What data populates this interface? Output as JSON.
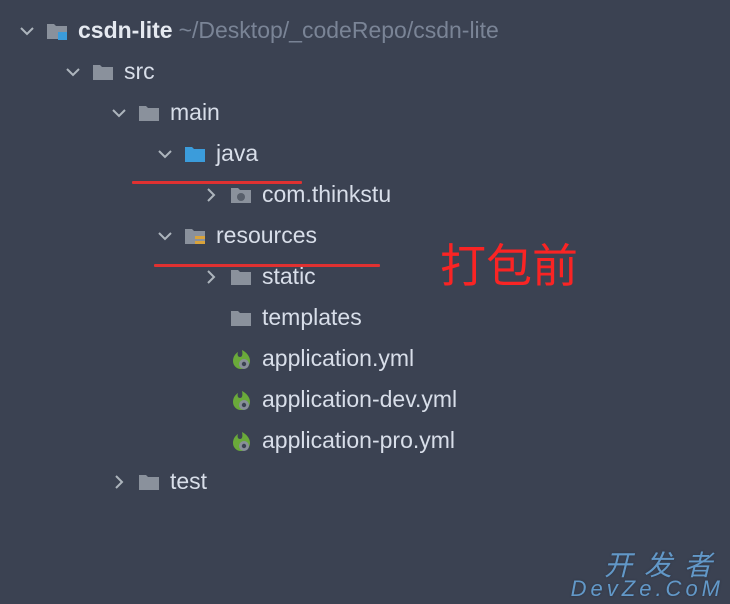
{
  "project": {
    "name": "csdn-lite",
    "path": "~/Desktop/_codeRepo/csdn-lite"
  },
  "tree": {
    "src": {
      "label": "src",
      "main": {
        "label": "main",
        "java": {
          "label": "java",
          "package": "com.thinkstu"
        },
        "resources": {
          "label": "resources",
          "static": "static",
          "templates": "templates",
          "files": {
            "app": "application.yml",
            "dev": "application-dev.yml",
            "pro": "application-pro.yml"
          }
        }
      },
      "test": {
        "label": "test"
      }
    }
  },
  "annotation": "打包前",
  "watermark": {
    "line1": "开发者",
    "line2": "DevZe.CoM"
  }
}
